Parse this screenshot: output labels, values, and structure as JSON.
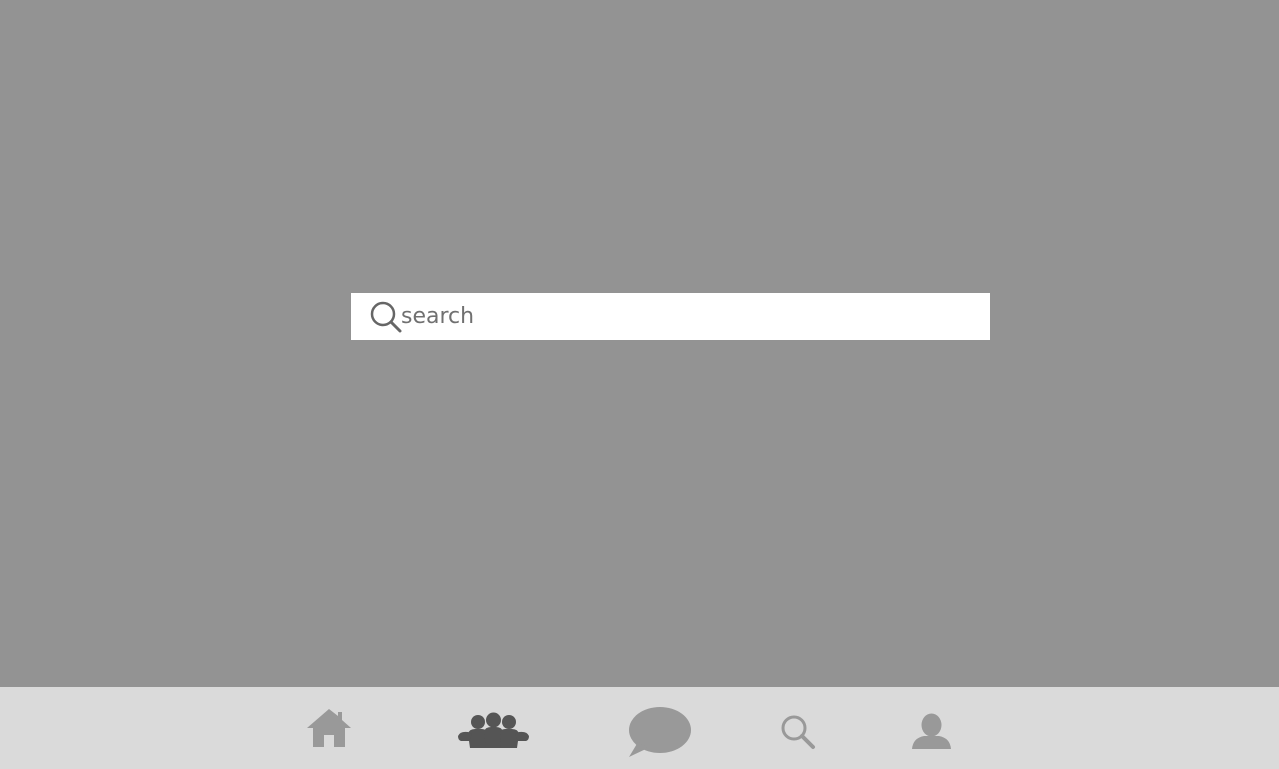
{
  "search": {
    "placeholder": "search",
    "value": "",
    "icon": "search-icon"
  },
  "nav": {
    "items": [
      {
        "id": "home",
        "icon": "home-icon",
        "active": false
      },
      {
        "id": "groups",
        "icon": "people-group-icon",
        "active": true
      },
      {
        "id": "chat",
        "icon": "chat-bubble-icon",
        "active": false
      },
      {
        "id": "search",
        "icon": "search-icon",
        "active": false
      },
      {
        "id": "profile",
        "icon": "user-icon",
        "active": false
      }
    ]
  },
  "colors": {
    "background": "#939393",
    "nav_background": "#dadada",
    "nav_icon": "#999999",
    "nav_icon_active": "#555555",
    "search_field": "#ffffff"
  }
}
